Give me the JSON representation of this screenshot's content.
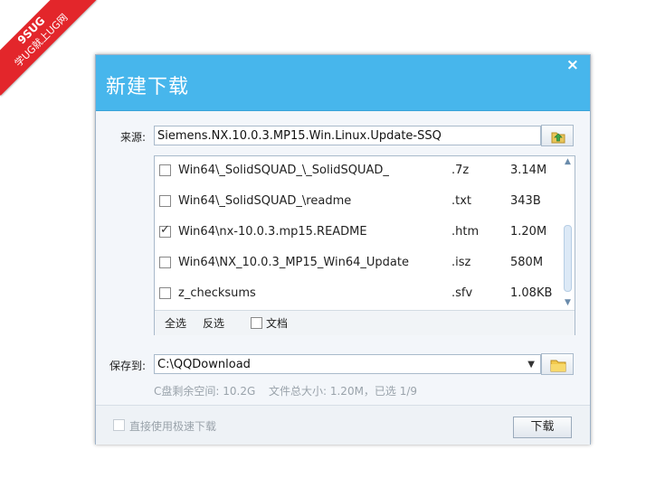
{
  "watermark": {
    "line1": "9SUG",
    "line2": "学UG就上UG网"
  },
  "dialog": {
    "title": "新建下载",
    "close_icon": "×"
  },
  "source": {
    "label": "来源:",
    "value": "Siemens.NX.10.0.3.MP15.Win.Linux.Update-SSQ"
  },
  "files": [
    {
      "name": "Win64\\_SolidSQUAD_\\_SolidSQUAD_",
      "ext": ".7z",
      "size": "3.14M",
      "checked": false
    },
    {
      "name": "Win64\\_SolidSQUAD_\\readme",
      "ext": ".txt",
      "size": "343B",
      "checked": false
    },
    {
      "name": "Win64\\nx-10.0.3.mp15.README",
      "ext": ".htm",
      "size": "1.20M",
      "checked": true
    },
    {
      "name": "Win64\\NX_10.0.3_MP15_Win64_Update",
      "ext": ".isz",
      "size": "580M",
      "checked": false
    },
    {
      "name": "z_checksums",
      "ext": ".sfv",
      "size": "1.08KB",
      "checked": false
    }
  ],
  "list_footer": {
    "select_all": "全选",
    "invert": "反选",
    "doc_filter": "文档"
  },
  "save_to": {
    "label": "保存到:",
    "value": "C:\\QQDownload"
  },
  "info": {
    "disk_space": "C盘剩余空间: 10.2G",
    "selection": "文件总大小: 1.20M，已选 1/9"
  },
  "bottom": {
    "fast_download": "直接使用极速下载",
    "download_button": "下载"
  }
}
